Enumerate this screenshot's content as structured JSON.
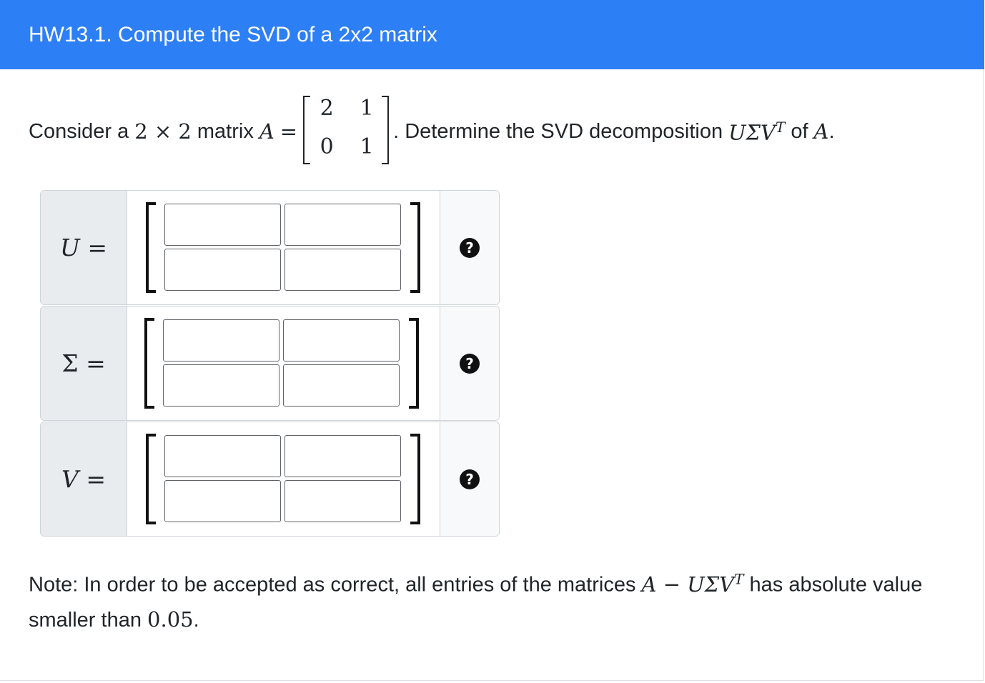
{
  "header": {
    "title": "HW13.1. Compute the SVD of a 2x2 matrix"
  },
  "prompt": {
    "consider": "Consider a",
    "size_expr": "2 × 2",
    "matrix_word": "matrix",
    "var": "A",
    "eq": "=",
    "matrix_A": [
      [
        "2",
        "1"
      ],
      [
        "0",
        "1"
      ]
    ],
    "determine": ". Determine the SVD decomposition",
    "svd_base": "UΣV",
    "svd_sup": "T",
    "of": "of",
    "end_var": "A",
    "end_punct": "."
  },
  "answers": [
    {
      "label_var": "U",
      "label_eq": "=",
      "entries": [
        "",
        "",
        "",
        ""
      ],
      "help_glyph": "?"
    },
    {
      "label_var": "Σ",
      "label_eq": "=",
      "entries": [
        "",
        "",
        "",
        ""
      ],
      "help_glyph": "?"
    },
    {
      "label_var": "V",
      "label_eq": "=",
      "entries": [
        "",
        "",
        "",
        ""
      ],
      "help_glyph": "?"
    }
  ],
  "note": {
    "text1": "Note: In order to be accepted as correct, all entries of the matrices",
    "expr": "A − UΣV",
    "expr_sup": "T",
    "text2": "has absolute value smaller than",
    "value": "0.05",
    "end": "."
  },
  "colors": {
    "header_bg": "#2d7ff5",
    "label_bg": "#e9ecef",
    "help_bg": "#f8f9fa"
  }
}
